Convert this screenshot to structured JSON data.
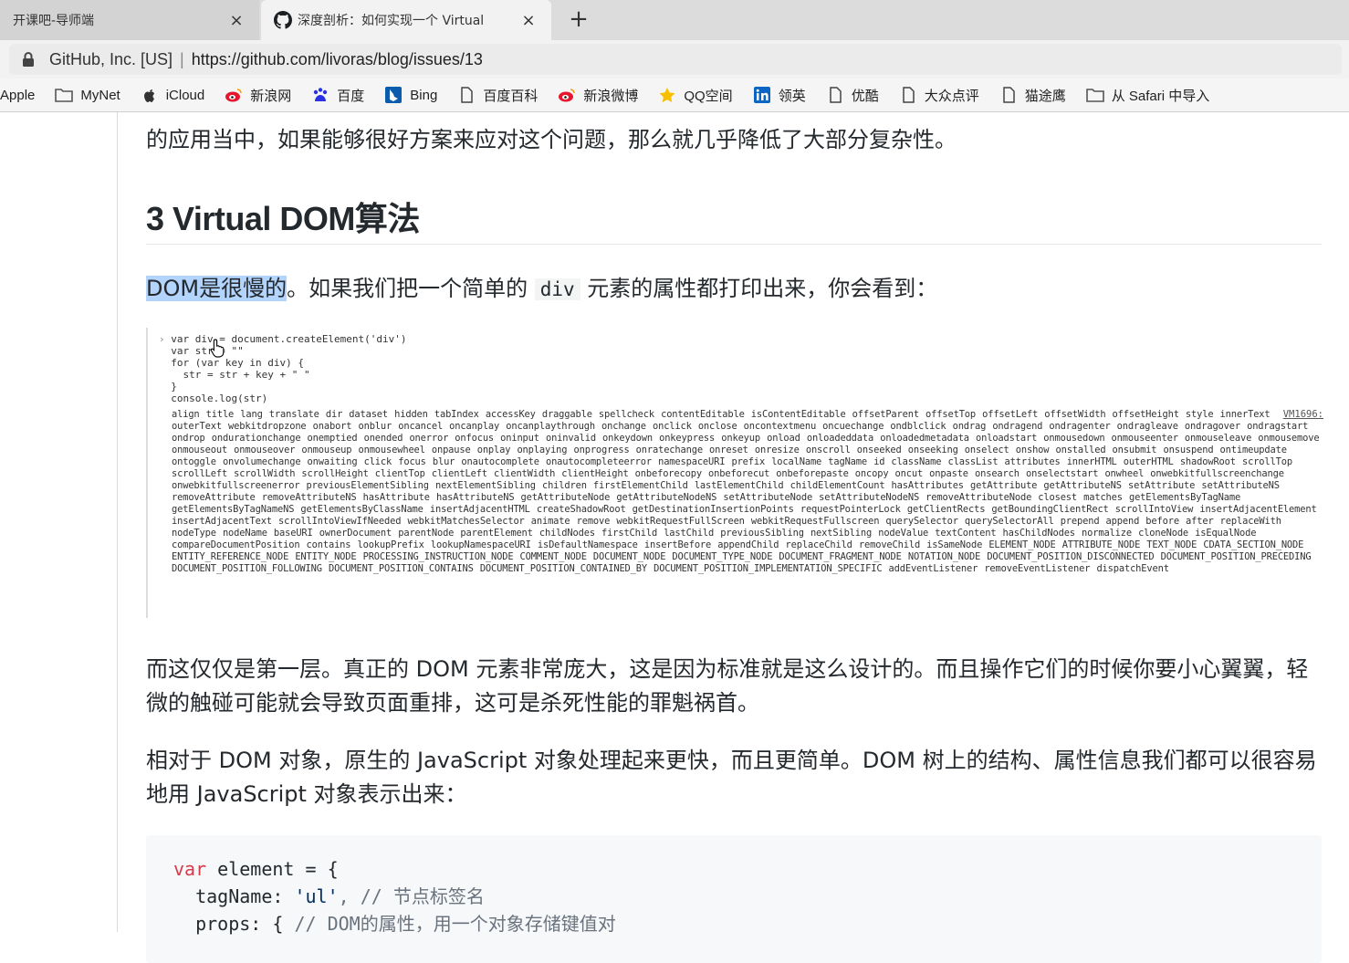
{
  "tabs": [
    {
      "title": "开课吧-导师端",
      "close": "×",
      "active": false
    },
    {
      "title": "深度剖析：如何实现一个 Virtual",
      "close": "×",
      "active": true,
      "icon": "github-icon"
    }
  ],
  "new_tab_label": "+",
  "address": {
    "org": "GitHub, Inc. [US]",
    "separator": "|",
    "url": "https://github.com/livoras/blog/issues/13"
  },
  "bookmarks": [
    {
      "label": "Apple",
      "icon": "apple-icon"
    },
    {
      "label": "MyNet",
      "icon": "folder-icon"
    },
    {
      "label": "iCloud",
      "icon": "apple-icon"
    },
    {
      "label": "新浪网",
      "icon": "weibo-icon"
    },
    {
      "label": "百度",
      "icon": "baidu-icon"
    },
    {
      "label": "Bing",
      "icon": "bing-icon"
    },
    {
      "label": "百度百科",
      "icon": "page-icon"
    },
    {
      "label": "新浪微博",
      "icon": "weibo-icon"
    },
    {
      "label": "QQ空间",
      "icon": "star-icon"
    },
    {
      "label": "领英",
      "icon": "linkedin-icon"
    },
    {
      "label": "优酷",
      "icon": "page-icon"
    },
    {
      "label": "大众点评",
      "icon": "page-icon"
    },
    {
      "label": "猫途鹰",
      "icon": "page-icon"
    },
    {
      "label": "从 Safari 中导入",
      "icon": "folder-icon"
    }
  ],
  "article": {
    "para1": "的应用当中，如果能够很好方案来应对这个问题，那么就几乎降低了大部分复杂性。",
    "heading": "3 Virtual DOM算法",
    "p2_highlight": "DOM是很慢的",
    "p2_a": "。如果我们把一个简单的",
    "p2_code": "div",
    "p2_b": "元素的属性都打印出来，你会看到：",
    "console": {
      "lines": [
        "var div = document.createElement('div')",
        "var str = \"\"",
        "for (var key in div) {",
        "  str = str + key + \" \"",
        "}",
        "console.log(str)"
      ],
      "vm_link": "VM1696:",
      "output": "align title lang translate dir dataset hidden tabIndex accessKey draggable spellcheck contentEditable isContentEditable offsetParent offsetTop offsetLeft offsetWidth offsetHeight style innerText outerText webkitdropzone onabort onblur oncancel oncanplay oncanplaythrough onchange onclick onclose oncontextmenu oncuechange ondblclick ondrag ondragend ondragenter ondragleave ondragover ondragstart ondrop ondurationchange onemptied onended onerror onfocus oninput oninvalid onkeydown onkeypress onkeyup onload onloadeddata onloadedmetadata onloadstart onmousedown onmouseenter onmouseleave onmousemove onmouseout onmouseover onmouseup onmousewheel onpause onplay onplaying onprogress onratechange onreset onresize onscroll onseeked onseeking onselect onshow onstalled onsubmit onsuspend ontimeupdate ontoggle onvolumechange onwaiting click focus blur onautocomplete onautocompleteerror namespaceURI prefix localName tagName id className classList attributes innerHTML outerHTML shadowRoot scrollTop scrollLeft scrollWidth scrollHeight clientTop clientLeft clientWidth clientHeight onbeforecopy onbeforecut onbeforepaste oncopy oncut onpaste onsearch onselectstart onwheel onwebkitfullscreenchange onwebkitfullscreenerror previousElementSibling nextElementSibling children firstElementChild lastElementChild childElementCount hasAttributes getAttribute getAttributeNS setAttribute setAttributeNS removeAttribute removeAttributeNS hasAttribute hasAttributeNS getAttributeNode getAttributeNodeNS setAttributeNode setAttributeNodeNS removeAttributeNode closest matches getElementsByTagName getElementsByTagNameNS getElementsByClassName insertAdjacentHTML createShadowRoot getDestinationInsertionPoints requestPointerLock getClientRects getBoundingClientRect scrollIntoView insertAdjacentElement insertAdjacentText scrollIntoViewIfNeeded webkitMatchesSelector animate remove webkitRequestFullScreen webkitRequestFullscreen querySelector querySelectorAll prepend append before after replaceWith nodeType nodeName baseURI ownerDocument parentNode parentElement childNodes firstChild lastChild previousSibling nextSibling nodeValue textContent hasChildNodes normalize cloneNode isEqualNode compareDocumentPosition contains lookupPrefix lookupNamespaceURI isDefaultNamespace insertBefore appendChild replaceChild removeChild isSameNode ELEMENT_NODE ATTRIBUTE_NODE TEXT_NODE CDATA_SECTION_NODE ENTITY_REFERENCE_NODE ENTITY_NODE PROCESSING_INSTRUCTION_NODE COMMENT_NODE DOCUMENT_NODE DOCUMENT_TYPE_NODE DOCUMENT_FRAGMENT_NODE NOTATION_NODE DOCUMENT_POSITION_DISCONNECTED DOCUMENT_POSITION_PRECEDING DOCUMENT_POSITION_FOLLOWING DOCUMENT_POSITION_CONTAINS DOCUMENT_POSITION_CONTAINED_BY DOCUMENT_POSITION_IMPLEMENTATION_SPECIFIC addEventListener removeEventListener dispatchEvent"
    },
    "p3": "而这仅仅是第一层。真正的 DOM 元素非常庞大，这是因为标准就是这么设计的。而且操作它们的时候你要小心翼翼，轻微的触碰可能就会导致页面重排，这可是杀死性能的罪魁祸首。",
    "p4": "相对于 DOM 对象，原生的 JavaScript 对象处理起来更快，而且更简单。DOM 树上的结构、属性信息我们都可以很容易地用 JavaScript 对象表示出来：",
    "code": {
      "l1_kw": "var",
      "l1_rest": " element = {",
      "l2_key": "  tagName: ",
      "l2_str": "'ul'",
      "l2_comment": ", // 节点标签名",
      "l3_key": "  props: { ",
      "l3_comment": "// DOM的属性，用一个对象存储键值对"
    }
  }
}
